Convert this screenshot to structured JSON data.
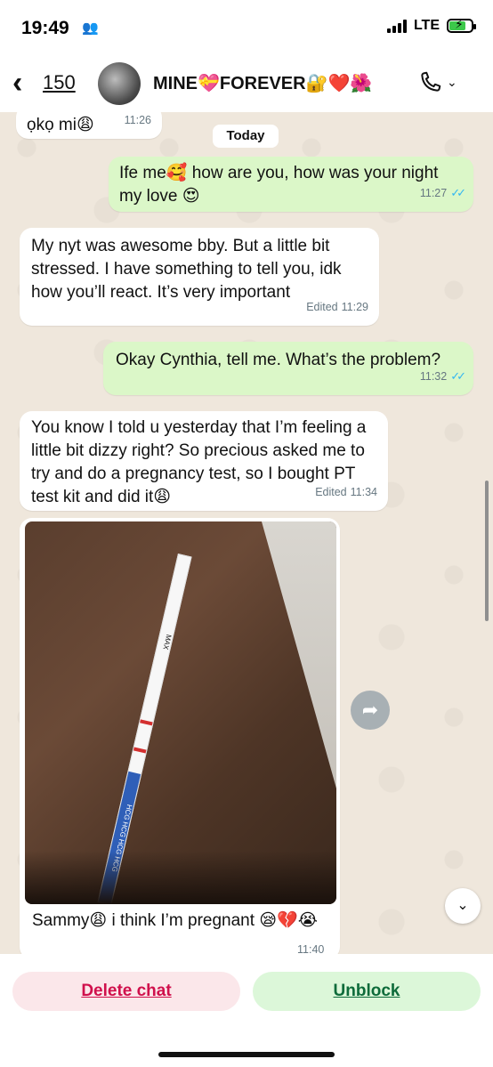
{
  "status_bar": {
    "time": "19:49",
    "network": "LTE",
    "icons": [
      "people-icon",
      "signal-icon",
      "battery-charging-icon"
    ]
  },
  "header": {
    "back_count": "150",
    "contact_name": "MINE💝FOREVER🔐❤️🌺",
    "icons": [
      "back-chevron-icon",
      "phone-icon",
      "chevron-down-icon"
    ]
  },
  "chat": {
    "day_label": "Today",
    "messages": [
      {
        "direction": "in",
        "text": "ọkọ mi😩",
        "time": "11:26"
      },
      {
        "direction": "out",
        "text": "Ife me🥰 how are you, how was your night my love 😍",
        "time": "11:27",
        "status": "read"
      },
      {
        "direction": "in",
        "text": "My nyt was awesome bby. But a little bit stressed. I have something to tell you, idk how you’ll react. It’s very important",
        "time": "11:29",
        "edited": "Edited"
      },
      {
        "direction": "out",
        "text": "Okay Cynthia, tell me. What’s the problem?",
        "time": "11:32",
        "status": "read"
      },
      {
        "direction": "in",
        "text": "You know I told u yesterday that I’m feeling a little bit dizzy right? So precious asked me to try and do a pregnancy test, so I bought PT test kit and did it😩",
        "time": "11:34",
        "edited": "Edited"
      },
      {
        "direction": "in",
        "type": "image",
        "caption": "Sammy😩 i think I’m pregnant 😪💔😭",
        "time": "11:40",
        "image_text": [
          "MAX",
          "HCG HCG HCG HCG"
        ]
      }
    ]
  },
  "footer": {
    "delete_label": "Delete chat",
    "unblock_label": "Unblock"
  },
  "colors": {
    "incoming_bubble": "#ffffff",
    "outgoing_bubble": "#dbf7c8",
    "read_ticks": "#34b7f1",
    "delete_text": "#d0104c",
    "unblock_text": "#0d6b3a"
  }
}
